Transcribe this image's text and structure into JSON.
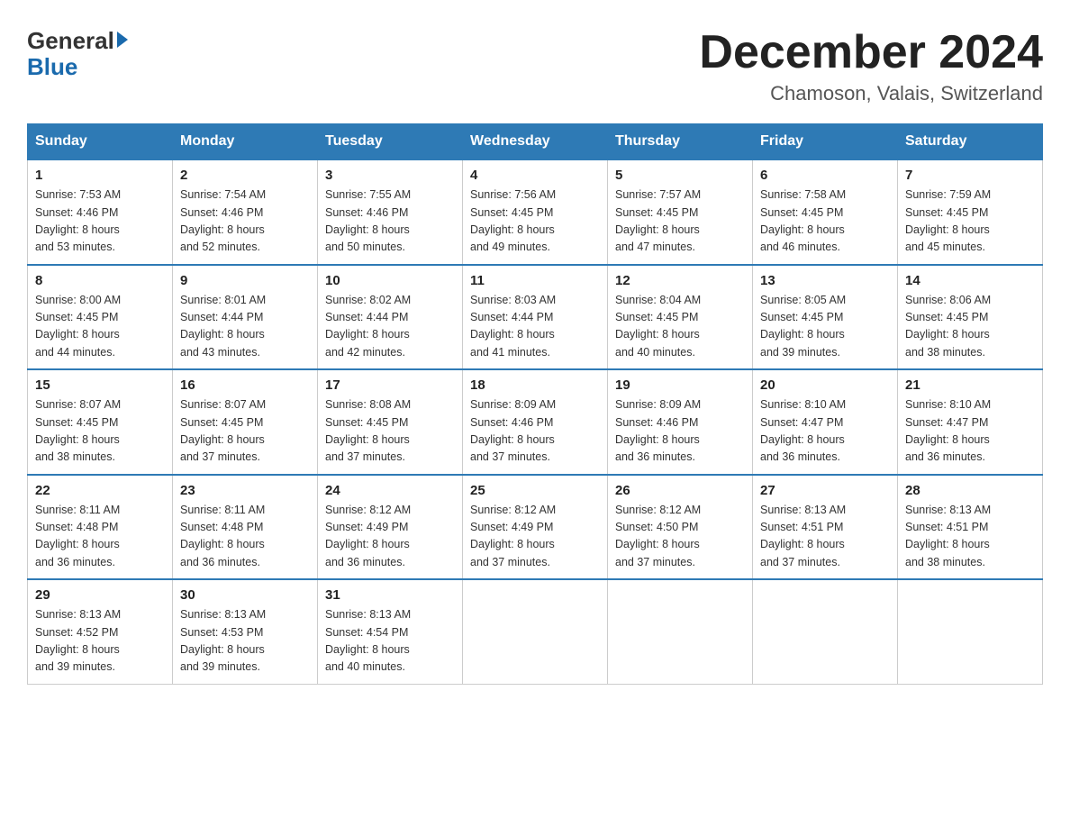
{
  "header": {
    "logo_general": "General",
    "logo_blue": "Blue",
    "month_title": "December 2024",
    "subtitle": "Chamoson, Valais, Switzerland"
  },
  "columns": [
    "Sunday",
    "Monday",
    "Tuesday",
    "Wednesday",
    "Thursday",
    "Friday",
    "Saturday"
  ],
  "weeks": [
    [
      {
        "day": "1",
        "sunrise": "7:53 AM",
        "sunset": "4:46 PM",
        "daylight": "8 hours and 53 minutes."
      },
      {
        "day": "2",
        "sunrise": "7:54 AM",
        "sunset": "4:46 PM",
        "daylight": "8 hours and 52 minutes."
      },
      {
        "day": "3",
        "sunrise": "7:55 AM",
        "sunset": "4:46 PM",
        "daylight": "8 hours and 50 minutes."
      },
      {
        "day": "4",
        "sunrise": "7:56 AM",
        "sunset": "4:45 PM",
        "daylight": "8 hours and 49 minutes."
      },
      {
        "day": "5",
        "sunrise": "7:57 AM",
        "sunset": "4:45 PM",
        "daylight": "8 hours and 47 minutes."
      },
      {
        "day": "6",
        "sunrise": "7:58 AM",
        "sunset": "4:45 PM",
        "daylight": "8 hours and 46 minutes."
      },
      {
        "day": "7",
        "sunrise": "7:59 AM",
        "sunset": "4:45 PM",
        "daylight": "8 hours and 45 minutes."
      }
    ],
    [
      {
        "day": "8",
        "sunrise": "8:00 AM",
        "sunset": "4:45 PM",
        "daylight": "8 hours and 44 minutes."
      },
      {
        "day": "9",
        "sunrise": "8:01 AM",
        "sunset": "4:44 PM",
        "daylight": "8 hours and 43 minutes."
      },
      {
        "day": "10",
        "sunrise": "8:02 AM",
        "sunset": "4:44 PM",
        "daylight": "8 hours and 42 minutes."
      },
      {
        "day": "11",
        "sunrise": "8:03 AM",
        "sunset": "4:44 PM",
        "daylight": "8 hours and 41 minutes."
      },
      {
        "day": "12",
        "sunrise": "8:04 AM",
        "sunset": "4:45 PM",
        "daylight": "8 hours and 40 minutes."
      },
      {
        "day": "13",
        "sunrise": "8:05 AM",
        "sunset": "4:45 PM",
        "daylight": "8 hours and 39 minutes."
      },
      {
        "day": "14",
        "sunrise": "8:06 AM",
        "sunset": "4:45 PM",
        "daylight": "8 hours and 38 minutes."
      }
    ],
    [
      {
        "day": "15",
        "sunrise": "8:07 AM",
        "sunset": "4:45 PM",
        "daylight": "8 hours and 38 minutes."
      },
      {
        "day": "16",
        "sunrise": "8:07 AM",
        "sunset": "4:45 PM",
        "daylight": "8 hours and 37 minutes."
      },
      {
        "day": "17",
        "sunrise": "8:08 AM",
        "sunset": "4:45 PM",
        "daylight": "8 hours and 37 minutes."
      },
      {
        "day": "18",
        "sunrise": "8:09 AM",
        "sunset": "4:46 PM",
        "daylight": "8 hours and 37 minutes."
      },
      {
        "day": "19",
        "sunrise": "8:09 AM",
        "sunset": "4:46 PM",
        "daylight": "8 hours and 36 minutes."
      },
      {
        "day": "20",
        "sunrise": "8:10 AM",
        "sunset": "4:47 PM",
        "daylight": "8 hours and 36 minutes."
      },
      {
        "day": "21",
        "sunrise": "8:10 AM",
        "sunset": "4:47 PM",
        "daylight": "8 hours and 36 minutes."
      }
    ],
    [
      {
        "day": "22",
        "sunrise": "8:11 AM",
        "sunset": "4:48 PM",
        "daylight": "8 hours and 36 minutes."
      },
      {
        "day": "23",
        "sunrise": "8:11 AM",
        "sunset": "4:48 PM",
        "daylight": "8 hours and 36 minutes."
      },
      {
        "day": "24",
        "sunrise": "8:12 AM",
        "sunset": "4:49 PM",
        "daylight": "8 hours and 36 minutes."
      },
      {
        "day": "25",
        "sunrise": "8:12 AM",
        "sunset": "4:49 PM",
        "daylight": "8 hours and 37 minutes."
      },
      {
        "day": "26",
        "sunrise": "8:12 AM",
        "sunset": "4:50 PM",
        "daylight": "8 hours and 37 minutes."
      },
      {
        "day": "27",
        "sunrise": "8:13 AM",
        "sunset": "4:51 PM",
        "daylight": "8 hours and 37 minutes."
      },
      {
        "day": "28",
        "sunrise": "8:13 AM",
        "sunset": "4:51 PM",
        "daylight": "8 hours and 38 minutes."
      }
    ],
    [
      {
        "day": "29",
        "sunrise": "8:13 AM",
        "sunset": "4:52 PM",
        "daylight": "8 hours and 39 minutes."
      },
      {
        "day": "30",
        "sunrise": "8:13 AM",
        "sunset": "4:53 PM",
        "daylight": "8 hours and 39 minutes."
      },
      {
        "day": "31",
        "sunrise": "8:13 AM",
        "sunset": "4:54 PM",
        "daylight": "8 hours and 40 minutes."
      },
      null,
      null,
      null,
      null
    ]
  ]
}
